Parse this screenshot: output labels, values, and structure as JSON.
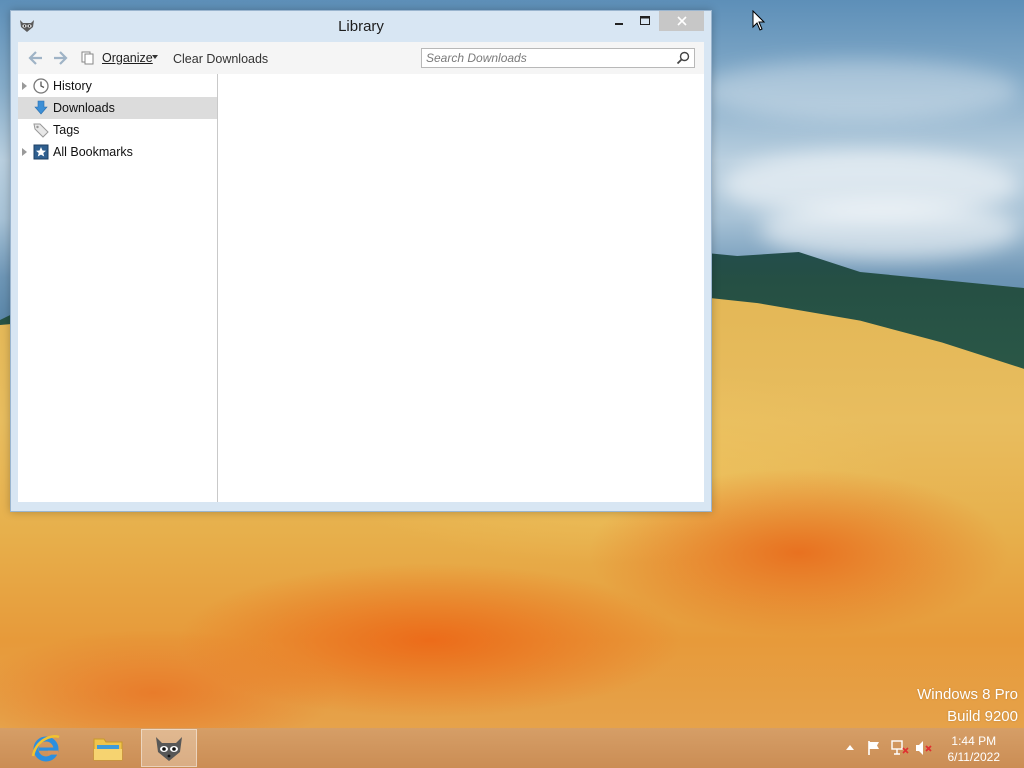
{
  "window": {
    "title": "Library",
    "toolbar": {
      "organize_label": "Organize",
      "clear_downloads_label": "Clear Downloads",
      "search_placeholder": "Search Downloads"
    },
    "sidebar": {
      "items": [
        {
          "label": "History",
          "icon": "clock-icon",
          "expandable": true,
          "selected": false
        },
        {
          "label": "Downloads",
          "icon": "download-arrow-icon",
          "expandable": false,
          "selected": true
        },
        {
          "label": "Tags",
          "icon": "tag-icon",
          "expandable": false,
          "selected": false
        },
        {
          "label": "All Bookmarks",
          "icon": "bookmark-star-icon",
          "expandable": true,
          "selected": false
        }
      ]
    }
  },
  "desktop": {
    "watermark_line1": "Windows 8 Pro",
    "watermark_line2": "Build 9200"
  },
  "taskbar": {
    "apps": [
      {
        "name": "internet-explorer",
        "icon": "ie-icon",
        "active": false
      },
      {
        "name": "file-explorer",
        "icon": "folder-icon",
        "active": false
      },
      {
        "name": "firefox-library",
        "icon": "raccoon-icon",
        "active": true
      }
    ],
    "clock": {
      "time": "1:44 PM",
      "date": "6/11/2022"
    }
  },
  "colors": {
    "window_frame": "#d8e6f3",
    "selected_row": "#dcdcdc",
    "taskbar": "#cf9359",
    "close_button": "#c7c7c7"
  }
}
